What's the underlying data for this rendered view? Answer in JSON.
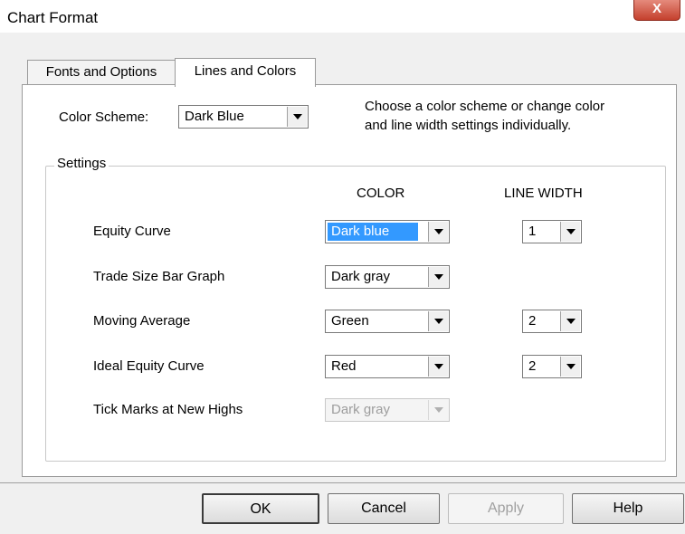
{
  "window": {
    "title": "Chart Format",
    "close_label": "X"
  },
  "tabs": [
    {
      "label": "Fonts and Options",
      "active": false
    },
    {
      "label": "Lines and Colors",
      "active": true
    }
  ],
  "color_scheme": {
    "label": "Color Scheme:",
    "value": "Dark Blue",
    "help_line1": "Choose a color scheme or change color",
    "help_line2": "and line width settings individually."
  },
  "settings": {
    "group_label": "Settings",
    "color_header": "COLOR",
    "width_header": "LINE WIDTH",
    "rows": [
      {
        "label": "Equity Curve",
        "color": "Dark blue",
        "width": "1"
      },
      {
        "label": "Trade Size Bar Graph",
        "color": "Dark gray",
        "width": ""
      },
      {
        "label": "Moving Average",
        "color": "Green",
        "width": "2"
      },
      {
        "label": "Ideal Equity Curve",
        "color": "Red",
        "width": "2"
      },
      {
        "label": "Tick Marks at New Highs",
        "color": "Dark gray",
        "width": ""
      }
    ]
  },
  "buttons": {
    "ok": "OK",
    "cancel": "Cancel",
    "apply": "Apply",
    "help": "Help"
  }
}
